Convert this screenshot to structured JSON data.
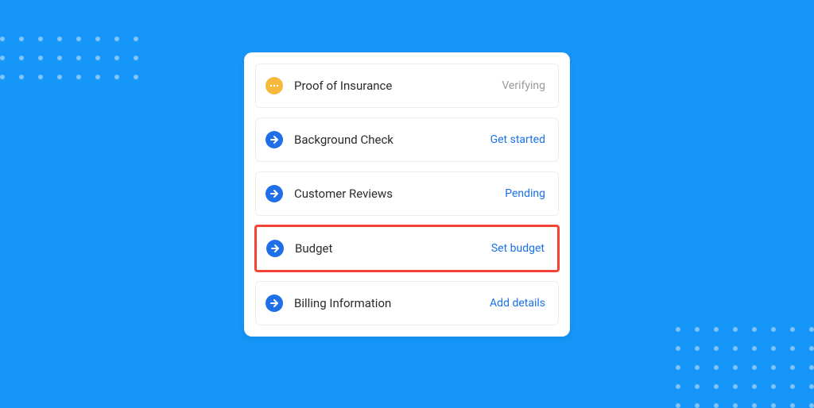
{
  "checklist": {
    "items": [
      {
        "icon": "verifying-icon",
        "iconKind": "pending-yellow",
        "label": "Proof of Insurance",
        "status": "Verifying",
        "statusKind": "muted",
        "highlighted": false
      },
      {
        "icon": "arrow-right-icon",
        "iconKind": "arrow-blue",
        "label": "Background Check",
        "status": "Get started",
        "statusKind": "link",
        "highlighted": false
      },
      {
        "icon": "arrow-right-icon",
        "iconKind": "arrow-blue",
        "label": "Customer Reviews",
        "status": "Pending",
        "statusKind": "link",
        "highlighted": false
      },
      {
        "icon": "arrow-right-icon",
        "iconKind": "arrow-blue",
        "label": "Budget",
        "status": "Set budget",
        "statusKind": "link",
        "highlighted": true
      },
      {
        "icon": "arrow-right-icon",
        "iconKind": "arrow-blue",
        "label": "Billing Information",
        "status": "Add details",
        "statusKind": "link",
        "highlighted": false
      }
    ]
  },
  "colors": {
    "background": "#1696F9",
    "highlightBorder": "#F44336",
    "link": "#1971E6",
    "muted": "#9A9A9A",
    "yellow": "#F6B93B",
    "blue": "#1E6FE8"
  }
}
